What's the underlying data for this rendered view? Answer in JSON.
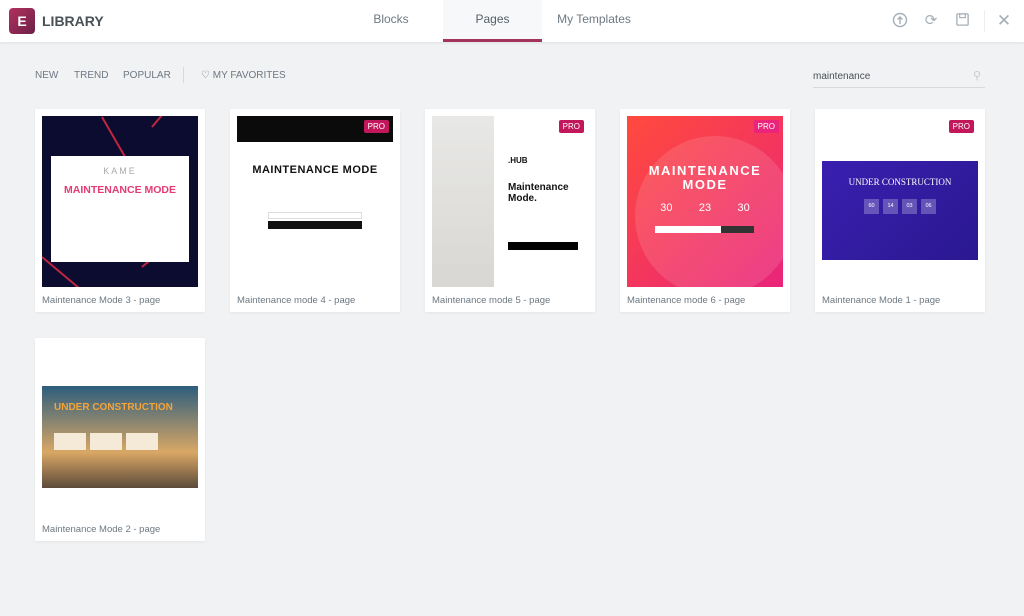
{
  "header": {
    "logo_letter": "E",
    "title": "LIBRARY",
    "tabs": [
      {
        "label": "Blocks"
      },
      {
        "label": "Pages",
        "active": true
      },
      {
        "label": "My Templates"
      }
    ],
    "accent": "#a4345d",
    "icons": [
      "import-icon",
      "sync-icon",
      "save-icon",
      "close-icon"
    ]
  },
  "filters": {
    "items": [
      "NEW",
      "TREND",
      "POPULAR"
    ],
    "favorites": "MY FAVORITES"
  },
  "search": {
    "value": "maintenance"
  },
  "templates": [
    {
      "label": "Maintenance Mode 3 - page",
      "pro": false,
      "brand": "KAME",
      "heading": "MAINTENANCE MODE"
    },
    {
      "label": "Maintenance mode 4 - page",
      "pro": true,
      "heading": "MAINTENANCE MODE"
    },
    {
      "label": "Maintenance mode 5 - page",
      "pro": true,
      "brand": ".HUB",
      "heading": "Maintenance Mode."
    },
    {
      "label": "Maintenance mode 6 - page",
      "pro": true,
      "heading": "MAINTENANCE MODE",
      "countdown": [
        "30",
        "23",
        "30"
      ]
    },
    {
      "label": "Maintenance Mode 1 - page",
      "pro": true,
      "heading": "UNDER CONSTRUCTION",
      "countdown": [
        "60",
        "14",
        "03",
        "06"
      ]
    },
    {
      "label": "Maintenance Mode 2 - page",
      "pro": false,
      "heading": "UNDER CONSTRUCTION"
    }
  ],
  "pro_label": "PRO"
}
